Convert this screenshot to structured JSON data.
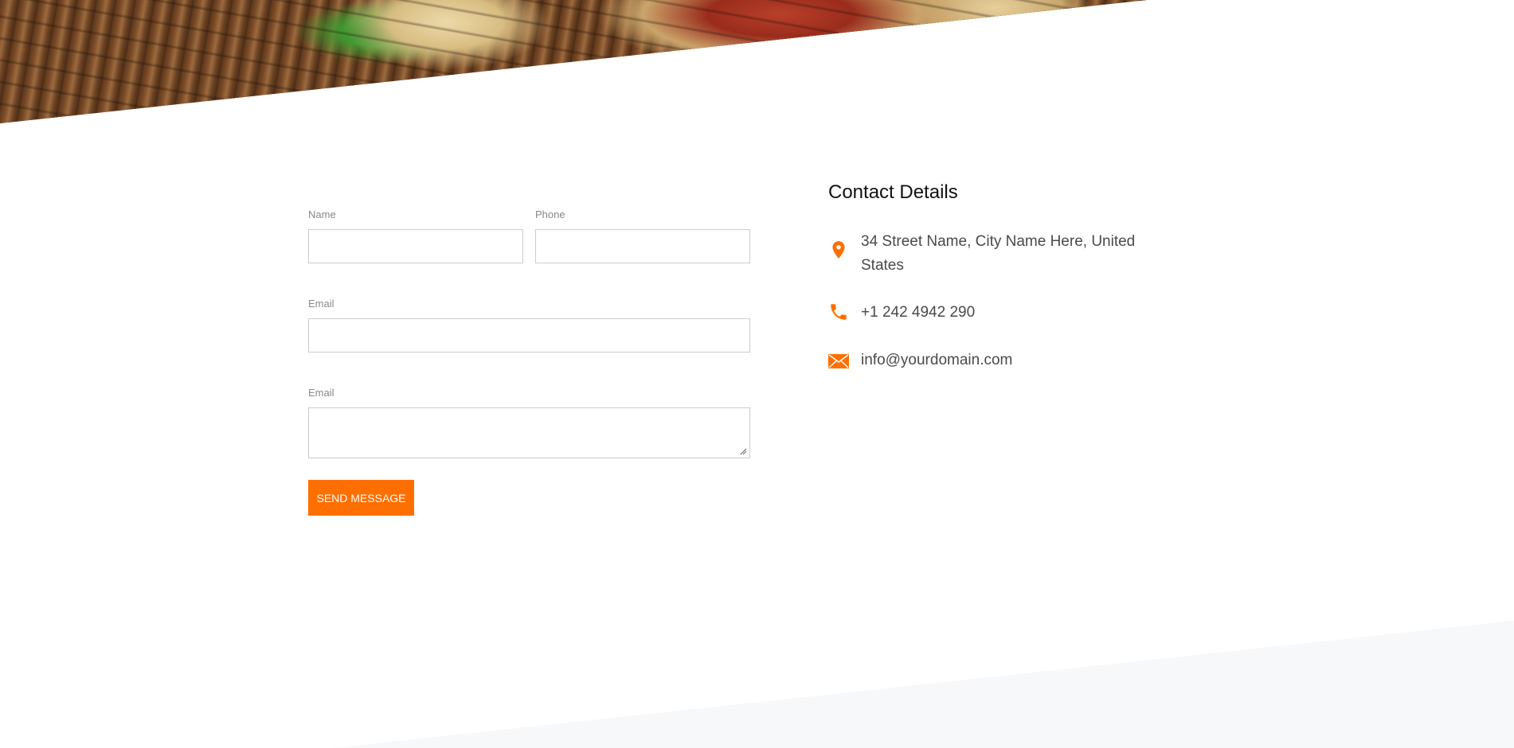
{
  "hero": {
    "image_alt": "pizza on wicker mat"
  },
  "form": {
    "name_label": "Name",
    "name_value": "",
    "phone_label": "Phone",
    "phone_value": "",
    "email_label": "Email",
    "email_value": "",
    "message_label": "Email",
    "message_value": "",
    "send_label": "SEND MESSAGE"
  },
  "contact": {
    "title": "Contact Details",
    "address": "34 Street Name, City Name Here, United States",
    "phone": "+1 242 4942 290",
    "email": "info@yourdomain.com",
    "accent_color": "#ff6f00"
  },
  "icons": {
    "address": "map-pin-icon",
    "phone": "phone-icon",
    "email": "envelope-icon"
  }
}
